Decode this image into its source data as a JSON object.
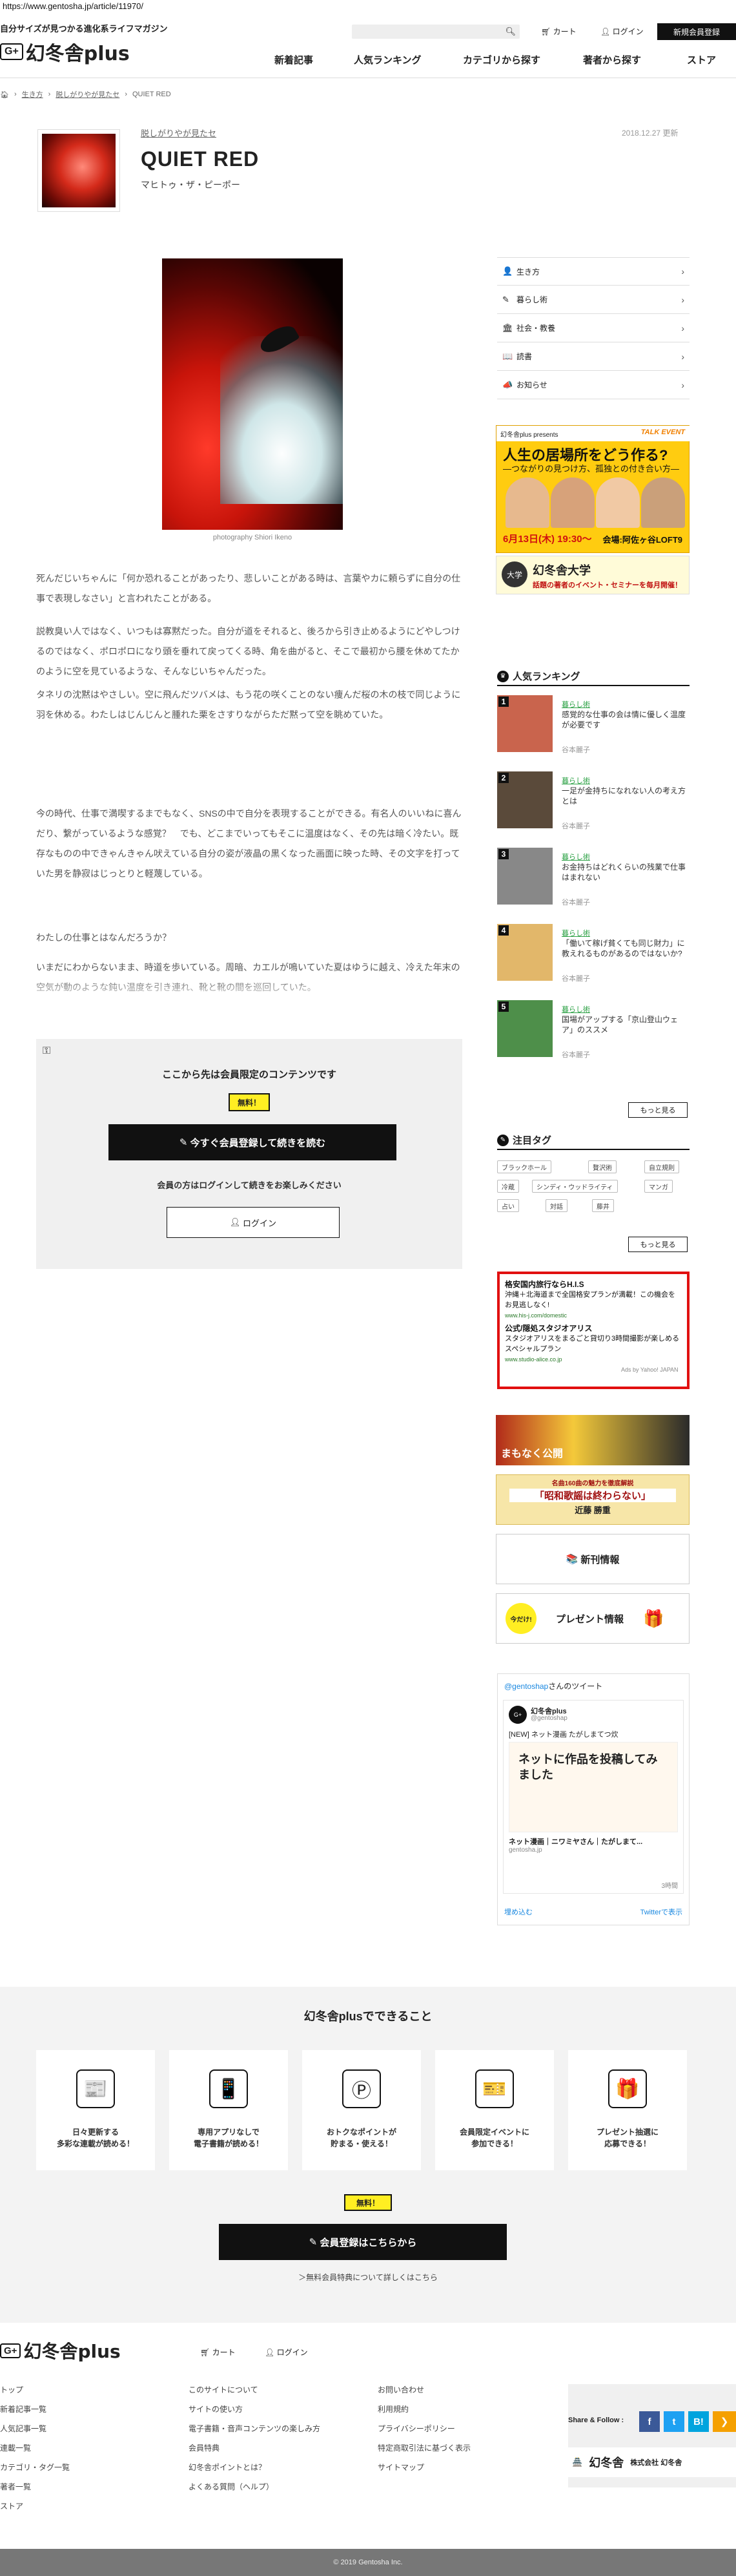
{
  "url": "https://www.gentosha.jp/article/11970/",
  "header": {
    "tagline": "自分サイズが見つかる進化系ライフマガジン",
    "logo_mark": "G+",
    "logo_text": "幻冬舎plus",
    "cart": "カート",
    "login": "ログイン",
    "register": "新規会員登録",
    "nav": [
      "新着記事",
      "人気ランキング",
      "カテゴリから探す",
      "著者から探す",
      "ストア"
    ]
  },
  "breadcrumb": [
    "生き方",
    "脱しがりやが見たセ",
    "QUIET RED"
  ],
  "article": {
    "category": "脱しがりやが見たセ",
    "title": "QUIET RED",
    "author": "マヒトゥ・ザ・ピーポー",
    "date": "2018.12.27 更新",
    "caption": "photography Shiori Ikeno",
    "paragraphs": [
      "死んだじいちゃんに「何か恐れることがあったり、悲しいことがある時は、言葉やカに頼らずに自分の仕事で表現しなさい」と言われたことがある。",
      "説教臭い人ではなく、いつもは寡黙だった。自分が道をそれると、後ろから引き止めるようにどやしつけるのではなく、ポロポロになり頭を垂れて戻ってくる時、角を曲がると、そこで最初から腰を休めてたかのように空を見ているような、そんなじいちゃんだった。",
      "タネリの沈黙はやさしい。空に飛んだツバメは、もう花の咲くことのない痩んだ桜の木の枝で同じように羽を休める。わたしはじんじんと腫れた栗をさすりながらただ黙って空を眺めていた。",
      "今の時代、仕事で満喫するまでもなく、SNSの中で自分を表現することができる。有名人のいいねに喜んだり、繋がっているような感覚？　でも、どこまでいってもそこに温度はなく、その先は暗く冷たい。既存なものの中できゃんきゃん吠えている自分の姿が液晶の黒くなった画面に映った時、その文字を打っていた男を静寂はじっとりと軽蔑している。",
      "わたしの仕事とはなんだろうか？",
      "いまだにわからないまま、時道を歩いている。周暗、カエルが鳴いていた夏はゆうに越え、冷えた年末の空気が動のような鈍い温度を引き連れ、靴と靴の間を巡回していた。"
    ]
  },
  "paywall": {
    "heading": "ここから先は会員限定のコンテンツです",
    "free": "無料！",
    "cta": "今すぐ会員登録して続きを読む",
    "note": "会員の方はログインして続きをお楽しみください",
    "login": "ログイン"
  },
  "sidebar": {
    "menu": [
      {
        "icon": "person-icon",
        "glyph": "👤",
        "label": "生き方"
      },
      {
        "icon": "pen-icon",
        "glyph": "✎",
        "label": "暮らし術"
      },
      {
        "icon": "building-icon",
        "glyph": "🏛",
        "label": "社会・教養"
      },
      {
        "icon": "book-icon",
        "glyph": "📖",
        "label": "読書"
      },
      {
        "icon": "megaphone-icon",
        "glyph": "📣",
        "label": "お知らせ"
      }
    ],
    "event": {
      "brand": "幻冬舎plus presents",
      "tag": "TALK EVENT",
      "question": "人生の居場所をどう作る?",
      "sub": "―つながりの見つけ方、孤独との付き合い方―",
      "date": "6月13日(木) 19:30〜",
      "place": "会場:阿佐ヶ谷LOFT9"
    },
    "university": {
      "name": "幻冬舎大学",
      "desc": "話題の著者のイベント・セミナーを毎月開催！",
      "logo": "大学"
    },
    "ranking_title": "人気ランキング",
    "ranking": [
      {
        "num": "1",
        "cat": "暮らし術",
        "title": "感覚的な仕事の会は情に優しく温度が必要です",
        "author": "谷本麗子",
        "color": "#c9644d"
      },
      {
        "num": "2",
        "cat": "暮らし術",
        "title": "一足が金持ちになれない人の考え方とは",
        "author": "谷本麗子",
        "color": "#5a4a3a"
      },
      {
        "num": "3",
        "cat": "暮らし術",
        "title": "お金持ちはどれくらいの残業で仕事はまれない",
        "author": "谷本麗子",
        "color": "#888"
      },
      {
        "num": "4",
        "cat": "暮らし術",
        "title": "「働いて稼げ貧くても同じ財力」に教えれるものがあるのではないか?",
        "author": "谷本麗子",
        "color": "#e2b76a"
      },
      {
        "num": "5",
        "cat": "暮らし術",
        "title": "国場がアップする「京山登山ウェア」のススメ",
        "author": "谷本麗子",
        "color": "#4e8f4a"
      }
    ],
    "more": "もっと見る",
    "tags_title": "注目タグ",
    "tags": [
      "ブラックホール",
      "贅沢術",
      "自立規則",
      "冷蔵",
      "シンディ・ウッドライティ",
      "マンガ",
      "占い",
      "対話",
      "藤井"
    ],
    "ad": {
      "h1": "格安国内旅行ならH.I.S",
      "t1": "沖縄＋北海道まで全国格安プランが満載！この機会をお見逃しなく!",
      "u1": "www.his-j.com/domestic",
      "h2": "公式/隠処スタジオアリス",
      "t2": "スタジオアリスをまるごと貸切り3時間撮影が楽しめるスペシャルプラン",
      "u2": "www.studio-alice.co.jp",
      "by": "Ads by Yahoo! JAPAN"
    },
    "banner_a": "まもなく公開",
    "banner_b_top": "名曲160曲の魅力を徹底解説",
    "banner_b_main": "「昭和歌謡は終わらない」",
    "banner_b_author": "近藤 勝重",
    "banner_c": "新刊情報",
    "banner_d": "プレゼント情報",
    "banner_d_badge": "今だけ!",
    "twitter": {
      "account": "@gentoshap",
      "suffix": "さんのツイート",
      "name": "幻冬舎plus",
      "handle": "@gentoshap",
      "text": "[NEW] ネット漫画 たがしまてつ炊",
      "manga": "ネットに作品を投稿してみました",
      "card_title": "ネット漫画｜ニワミヤさん｜たがしまて...",
      "card_domain": "gentosha.jp",
      "time": "3時間",
      "embed": "埋め込む",
      "view": "Twitterで表示"
    }
  },
  "features": {
    "title": "幻冬舎plusでできること",
    "items": [
      {
        "icon": "news-icon",
        "glyph": "📰",
        "text": "日々更新する\n多彩な連載が読める！"
      },
      {
        "icon": "phone-icon",
        "glyph": "📱",
        "text": "専用アプリなしで\n電子書籍が読める！"
      },
      {
        "icon": "points-icon",
        "glyph": "Ⓟ",
        "text": "おトクなポイントが\n貯まる・使える！"
      },
      {
        "icon": "ticket-icon",
        "glyph": "🎫",
        "text": "会員限定イベントに\n参加できる！"
      },
      {
        "icon": "gift-icon",
        "glyph": "🎁",
        "text": "プレゼント抽選に\n応募できる！"
      }
    ],
    "free": "無料！",
    "cta": "会員登録はこちらから",
    "note": "＞無料会員特典について詳しくはこちら"
  },
  "footer": {
    "cart": "カート",
    "login": "ログイン",
    "col1": [
      "トップ",
      "新着記事一覧",
      "人気記事一覧",
      "連載一覧",
      "カテゴリ・タグ一覧",
      "著者一覧",
      "ストア"
    ],
    "col2": [
      "このサイトについて",
      "サイトの使い方",
      "電子書籍・音声コンテンツの楽しみ方",
      "会員特典",
      "幻冬舎ポイントとは？",
      "よくある質問（ヘルプ）"
    ],
    "col3": [
      "お問い合わせ",
      "利用規約",
      "プライバシーポリシー",
      "特定商取引法に基づく表示",
      "サイトマップ"
    ],
    "share_label": "Share & Follow :",
    "gt_name": "幻冬舎",
    "gt_company": "株式会社 幻冬舎",
    "copyright": "© 2019 Gentosha Inc."
  },
  "colors": {
    "accent": "#111111",
    "badge": "#ffee22",
    "green": "#2aa043",
    "ad_border": "#e11010",
    "facebook": "#3b5998",
    "twitter": "#1da1f2",
    "hatena": "#00a4de"
  }
}
